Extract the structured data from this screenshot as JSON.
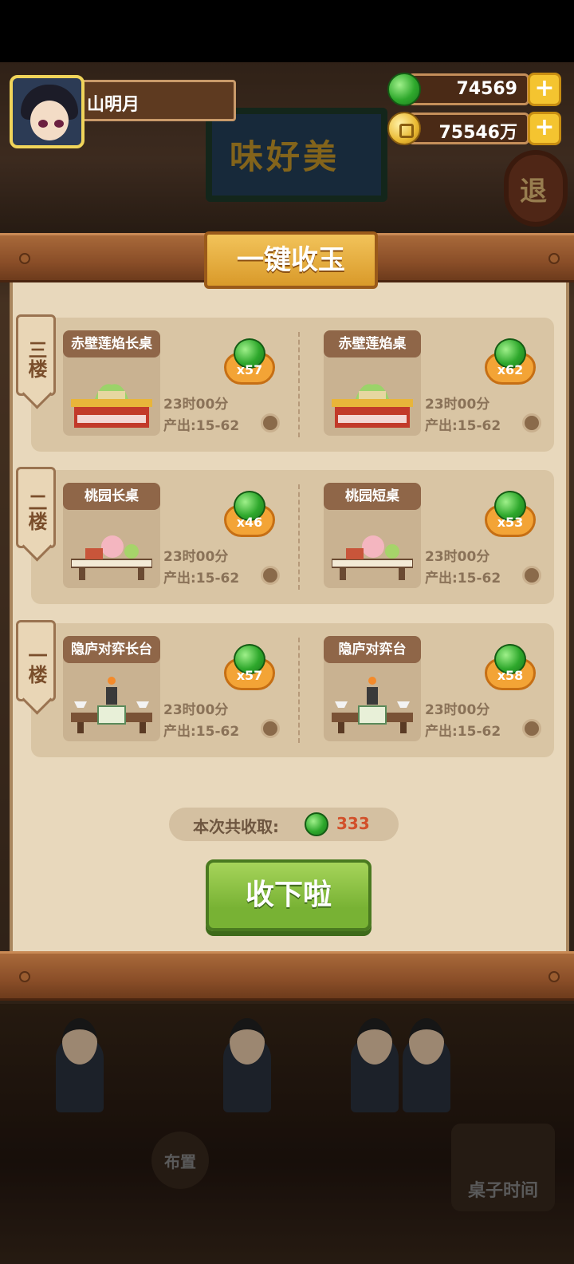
{
  "header": {
    "player_name": "山明月",
    "jade_amount": "74569",
    "coin_amount": "75546万",
    "add_symbol": "+"
  },
  "background": {
    "shop_sign": "味好美",
    "lantern_text": "退",
    "bottom_buttons": {
      "layout": "布置",
      "table_time": "桌子时间"
    }
  },
  "dialog": {
    "title": "一键收玉",
    "floors": [
      {
        "label": "三楼",
        "tables": [
          {
            "name": "赤壁莲焰长桌",
            "reward": "x57",
            "time": "23时00分",
            "output": "产出:15-62"
          },
          {
            "name": "赤壁莲焰桌",
            "reward": "x62",
            "time": "23时00分",
            "output": "产出:15-62"
          }
        ]
      },
      {
        "label": "二楼",
        "tables": [
          {
            "name": "桃园长桌",
            "reward": "x46",
            "time": "23时00分",
            "output": "产出:15-62"
          },
          {
            "name": "桃园短桌",
            "reward": "x53",
            "time": "23时00分",
            "output": "产出:15-62"
          }
        ]
      },
      {
        "label": "一楼",
        "tables": [
          {
            "name": "隐庐对弈长台",
            "reward": "x57",
            "time": "23时00分",
            "output": "产出:15-62"
          },
          {
            "name": "隐庐对弈台",
            "reward": "x58",
            "time": "23时00分",
            "output": "产出:15-62"
          }
        ]
      }
    ],
    "summary_label": "本次共收取:",
    "summary_value": "333",
    "collect_button": "收下啦"
  },
  "colors": {
    "accent_gold": "#f2c35a",
    "collect_green": "#78b234",
    "total_red": "#d2502a"
  }
}
